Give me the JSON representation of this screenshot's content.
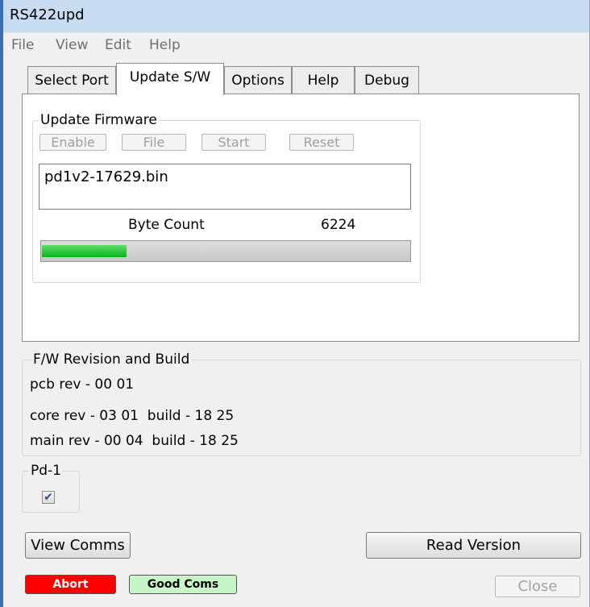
{
  "window": {
    "title": "RS422upd"
  },
  "menubar": {
    "items": [
      "File",
      "View",
      "Edit",
      "Help"
    ]
  },
  "tabs": [
    "Select Port",
    "Update S/W",
    "Options",
    "Help",
    "Debug"
  ],
  "active_tab": "Update S/W",
  "update_firmware": {
    "group_title": "Update Firmware",
    "buttons": {
      "enable": "Enable",
      "file": "File",
      "start": "Start",
      "reset": "Reset"
    },
    "filename": "pd1v2-17629.bin",
    "byte_count_label": "Byte Count",
    "byte_count_value": "6224",
    "progress_fraction": 0.23
  },
  "revision": {
    "group_title": "F/W Revision and Build",
    "pcb": "pcb rev - 00 01",
    "core": "core rev - 03 01  build - 18 25",
    "main": "main rev - 00 04  build - 18 25"
  },
  "pd1": {
    "group_title": "Pd-1",
    "checked": true
  },
  "buttons": {
    "view_comms": "View Comms",
    "read_version": "Read Version",
    "close": "Close"
  },
  "status": {
    "abort": "Abort",
    "abort_color": "#ff0000",
    "good": "Good Coms",
    "good_color": "#c8f5c8"
  }
}
